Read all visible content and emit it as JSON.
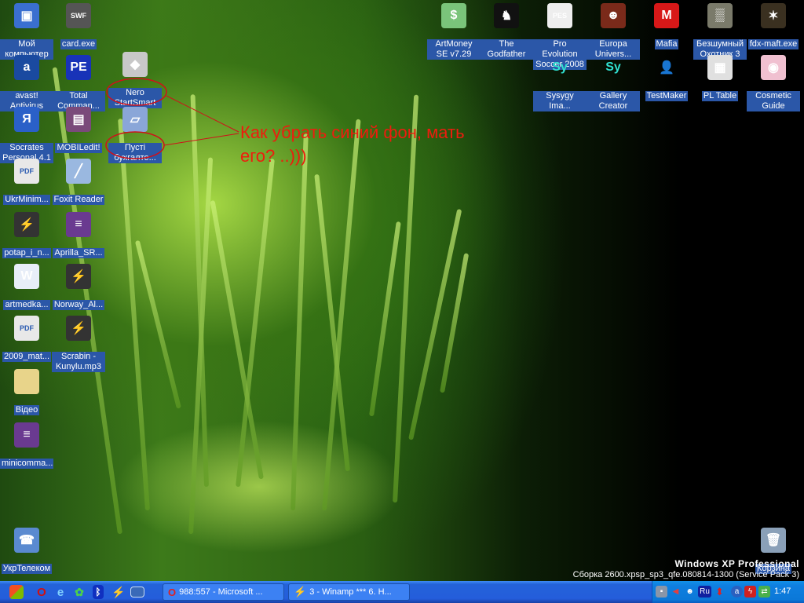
{
  "desktop": {
    "icons": [
      {
        "label": "Мой компьютер",
        "icon": "my-computer-icon",
        "color": "#3a6fd0",
        "glyph": "▣"
      },
      {
        "label": "card.exe",
        "icon": "swf-icon",
        "color": "#555",
        "glyph": "SWF"
      },
      {
        "label": "avast! Antivirus",
        "icon": "avast-icon",
        "color": "#1a4aa0",
        "glyph": "a"
      },
      {
        "label": "Total Comman...",
        "icon": "total-commander-icon",
        "color": "#1833b8",
        "glyph": "PE"
      },
      {
        "label": "Socrates Personal 4.1",
        "icon": "socrates-icon",
        "color": "#2a60c8",
        "glyph": "Я"
      },
      {
        "label": "MOBILedit!",
        "icon": "mobiledit-icon",
        "color": "#7a4a7a",
        "glyph": "▤"
      },
      {
        "label": "Nero StartSmart",
        "icon": "nero-icon",
        "color": "#c8c8c8",
        "glyph": "◆"
      },
      {
        "label": "Пусті бухгалте...",
        "icon": "document-icon",
        "color": "#8aa6d8",
        "glyph": "▱"
      },
      {
        "label": "UkrMinim...",
        "icon": "pdf-icon",
        "color": "#e8e8e8",
        "glyph": "PDF"
      },
      {
        "label": "Foxit Reader",
        "icon": "foxit-icon",
        "color": "#9ab8e0",
        "glyph": "╱"
      },
      {
        "label": "potap_i_n...",
        "icon": "winamp-icon",
        "color": "#333",
        "glyph": "⚡"
      },
      {
        "label": "Aprilla_SR...",
        "icon": "winrar-icon",
        "color": "#6a3a90",
        "glyph": "≡"
      },
      {
        "label": "artmedka...",
        "icon": "word-icon",
        "color": "#e8eef8",
        "glyph": "W"
      },
      {
        "label": "Norway_Al...",
        "icon": "winamp-icon",
        "color": "#333",
        "glyph": "⚡"
      },
      {
        "label": "2009_mat...",
        "icon": "pdf-icon",
        "color": "#e8e8e8",
        "glyph": "PDF"
      },
      {
        "label": "Scrabin - Kunylu.mp3",
        "icon": "winamp-icon",
        "color": "#333",
        "glyph": "⚡"
      },
      {
        "label": "Відео",
        "icon": "folder-icon",
        "color": "#e8d48a",
        "glyph": ""
      },
      {
        "label": "minicomma...",
        "icon": "winrar-icon",
        "color": "#6a3a90",
        "glyph": "≡"
      },
      {
        "label": "УкрТелеком",
        "icon": "network-connection-icon",
        "color": "#5a8ad0",
        "glyph": "☎"
      },
      {
        "label": "ArtMoney SE v7.29",
        "icon": "artmoney-icon",
        "color": "#7ac47a",
        "glyph": "$"
      },
      {
        "label": "The Godfather",
        "icon": "godfather-icon",
        "color": "#111",
        "glyph": "♞"
      },
      {
        "label": "Pro Evolution Soccer 2008",
        "icon": "pes-icon",
        "color": "#eee",
        "glyph": "PES"
      },
      {
        "label": "Europa Univers...",
        "icon": "europa-icon",
        "color": "#7a2a1a",
        "glyph": "☻"
      },
      {
        "label": "Mafia",
        "icon": "mafia-icon",
        "color": "#d81818",
        "glyph": "M"
      },
      {
        "label": "Безшумный Охотник 3",
        "icon": "hunter-icon",
        "color": "#7a7a6a",
        "glyph": "▒"
      },
      {
        "label": "fdx-maft.exe",
        "icon": "fdx-icon",
        "color": "#3a3020",
        "glyph": "✶"
      },
      {
        "label": "Sysygy Ima...",
        "icon": "syzygy-icon",
        "color": "transparent",
        "glyph": "Sy"
      },
      {
        "label": "Gallery Creator",
        "icon": "syzygy-icon",
        "color": "transparent",
        "glyph": "Sy"
      },
      {
        "label": "TestMaker",
        "icon": "user-icon",
        "color": "transparent",
        "glyph": "👤"
      },
      {
        "label": "PL Table",
        "icon": "table-icon",
        "color": "#e0e0e0",
        "glyph": "▦"
      },
      {
        "label": "Cosmetic Guide",
        "icon": "cosmetic-icon",
        "color": "#f0c0d0",
        "glyph": "◉"
      },
      {
        "label": "Корзина",
        "icon": "recycle-bin-icon",
        "color": "#8aa0b8",
        "glyph": "🗑"
      }
    ],
    "annotation": "Как убрать синий фон, мать его? ..)))",
    "watermark_title": "Windows XP Professional",
    "watermark_build": "Сборка 2600.xpsp_sp3_qfe.080814-1300 (Service Pack 3)",
    "annotation_color": "#ee1c0e"
  },
  "taskbar": {
    "quick_launch": [
      "start-windows-icon",
      "opera-icon",
      "internet-explorer-icon",
      "icq-icon",
      "bluetooth-icon",
      "winamp-icon",
      "show-desktop-icon"
    ],
    "tasks": [
      {
        "label": "988:557 - Microsoft ...",
        "icon": "opera-icon"
      },
      {
        "label": "3 - Winamp *** 6. H...",
        "icon": "winamp-icon"
      }
    ],
    "tray": {
      "language": "Ru",
      "clock": "1:47"
    }
  }
}
